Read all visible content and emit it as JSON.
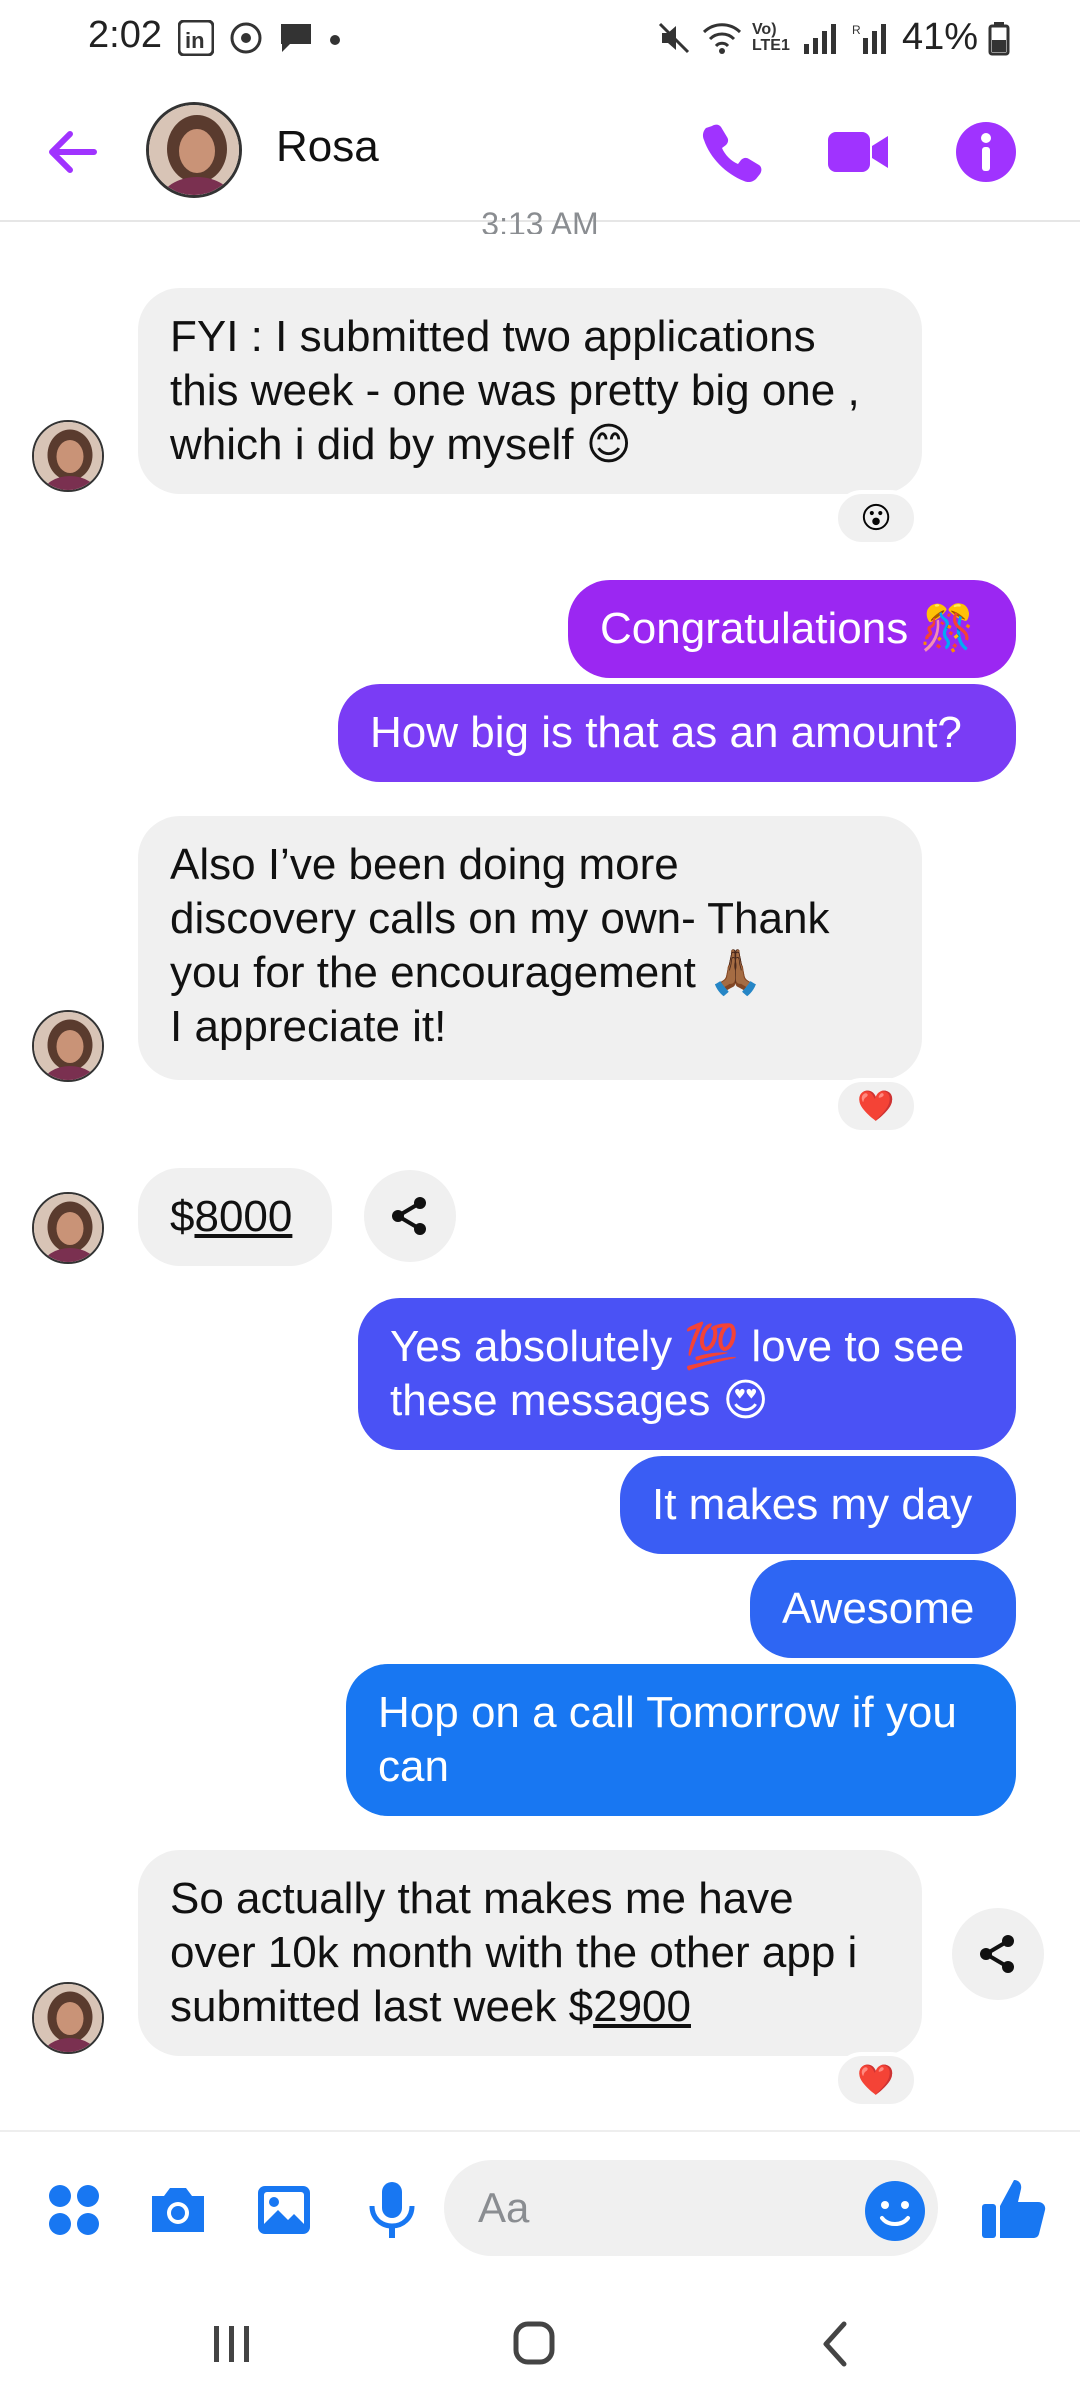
{
  "status_bar": {
    "time": "2:02",
    "battery": "41%",
    "network_label": "Vo) LTE1"
  },
  "header": {
    "contact_name": "Rosa"
  },
  "thread": {
    "partial_timestamp": "3:13 AM",
    "messages": [
      {
        "text": "FYI : I submitted two applications\nthis week - one was pretty big one ,\nwhich  i did by myself ",
        "emoji": "😊",
        "reaction": "😮"
      },
      {
        "text": "Congratulations ",
        "emoji": "🎊"
      },
      {
        "text": "How big is that as an amount?"
      },
      {
        "text": "Also I’ve been doing more\ndiscovery calls on my own- Thank\nyou for the encouragement ",
        "emoji": "🙏🏾",
        "text2": "\nI appreciate it!",
        "reaction": "❤️"
      },
      {
        "prefix": "$",
        "link": "8000"
      },
      {
        "text": "Yes absolutely ",
        "emoji": "💯",
        "text2": "  love to see\nthese messages ",
        "emoji2": "😍"
      },
      {
        "text": "It makes my day"
      },
      {
        "text": "Awesome"
      },
      {
        "text": "Hop on a call Tomorrow if you\ncan"
      },
      {
        "text": "So actually that makes me have\nover 10k month with the other app i\nsubmitted last week $",
        "link": "2900",
        "reaction": "❤️"
      }
    ]
  },
  "composer": {
    "placeholder": "Aa"
  },
  "colors": {
    "accent": "#a033ff",
    "purple_bubble": "#9b27f2",
    "violet_bubble": "#7a3cf5",
    "indigo_bubble": "#4a52f5",
    "blue_bubble": "#2a6cf2",
    "blue_last": "#1877f2",
    "incoming_bg": "#f0f0f0"
  }
}
